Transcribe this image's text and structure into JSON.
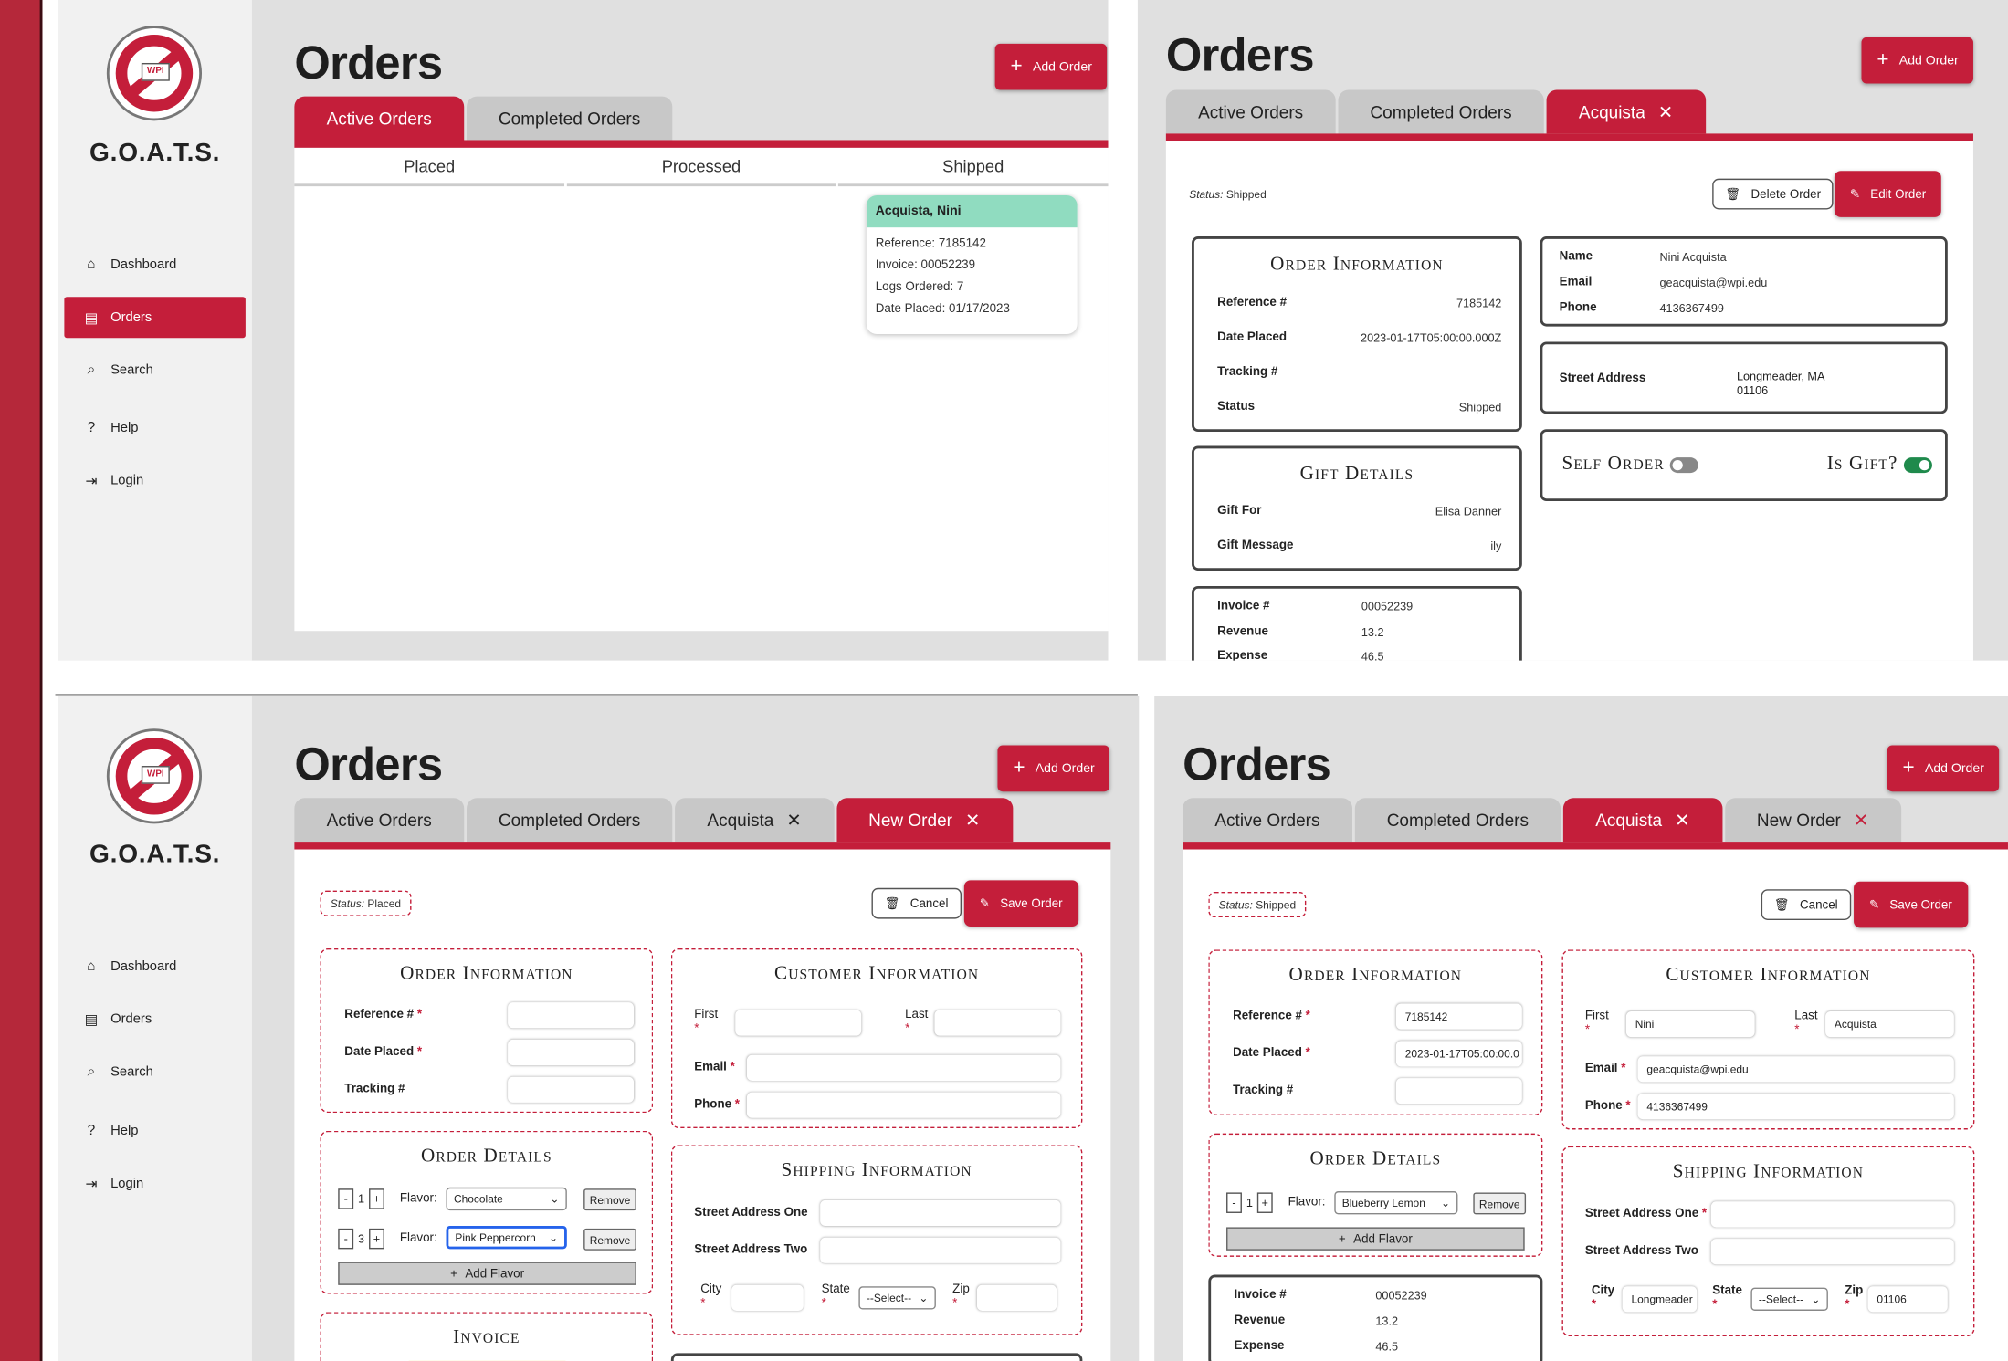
{
  "app": {
    "brand": "G.O.A.T.S.",
    "logo_text": "WPI"
  },
  "sidebar": {
    "items": [
      {
        "label": "Dashboard",
        "icon": "home-icon"
      },
      {
        "label": "Orders",
        "icon": "document-icon"
      },
      {
        "label": "Search",
        "icon": "search-icon"
      },
      {
        "label": "Help",
        "icon": "help-circle-icon"
      },
      {
        "label": "Login",
        "icon": "login-icon"
      }
    ]
  },
  "page": {
    "title": "Orders",
    "add_label": "Add Order"
  },
  "tabs": {
    "active": "Active Orders",
    "completed": "Completed Orders",
    "acquista": "Acquista",
    "new_order": "New Order"
  },
  "board": {
    "columns": [
      "Placed",
      "Processed",
      "Shipped"
    ],
    "card": {
      "name": "Acquista, Nini",
      "reference": "Reference: 7185142",
      "invoice": "Invoice: 00052239",
      "logs": "Logs Ordered: 7",
      "date": "Date Placed: 01/17/2023"
    }
  },
  "detail": {
    "status_label": "Status:",
    "status": "Shipped",
    "delete_label": "Delete Order",
    "edit_label": "Edit Order",
    "order_info": {
      "title": "Order Information",
      "rows": [
        {
          "k": "Reference #",
          "v": "7185142"
        },
        {
          "k": "Date Placed",
          "v": "2023-01-17T05:00:00.000Z"
        },
        {
          "k": "Tracking #",
          "v": ""
        },
        {
          "k": "Status",
          "v": "Shipped"
        }
      ]
    },
    "gift": {
      "title": "Gift Details",
      "rows": [
        {
          "k": "Gift For",
          "v": "Elisa Danner"
        },
        {
          "k": "Gift Message",
          "v": "ily"
        }
      ]
    },
    "invoice_rows": [
      {
        "k": "Invoice #",
        "v": "00052239"
      },
      {
        "k": "Revenue",
        "v": "13.2"
      },
      {
        "k": "Expense",
        "v": "46.5"
      }
    ],
    "customer": [
      {
        "k": "Name",
        "v": "Nini Acquista"
      },
      {
        "k": "Email",
        "v": "geacquista@wpi.edu"
      },
      {
        "k": "Phone",
        "v": "4136367499"
      }
    ],
    "address": {
      "k": "Street Address",
      "v1": "Longmeader, MA",
      "v2": "01106"
    },
    "self_order": "Self Order",
    "is_gift": "Is Gift?"
  },
  "form": {
    "status_label": "Status:",
    "cancel_label": "Cancel",
    "save_label": "Save Order",
    "order_info_title": "Order Information",
    "reference_label": "Reference #",
    "date_label": "Date Placed",
    "tracking_label": "Tracking #",
    "customer_title": "Customer Information",
    "first_label": "First",
    "last_label": "Last",
    "email_label": "Email",
    "phone_label": "Phone",
    "order_details_title": "Order Details",
    "flavor_label": "Flavor:",
    "remove_label": "Remove",
    "add_flavor_label": "Add Flavor",
    "shipping_title": "Shipping Information",
    "street1_label": "Street Address One",
    "street2_label": "Street Address Two",
    "city_label": "City",
    "state_label": "State",
    "zip_label": "Zip",
    "state_select": "--Select--",
    "invoice_title": "Invoice",
    "minus": "-",
    "plus": "+",
    "new_order": {
      "status": "Placed",
      "flavors": [
        {
          "qty": "1",
          "flavor": "Chocolate"
        },
        {
          "qty": "3",
          "flavor": "Pink Peppercorn"
        }
      ]
    },
    "edit_order": {
      "status": "Shipped",
      "reference": "7185142",
      "date": "2023-01-17T05:00:00.0",
      "tracking": "",
      "first": "Nini",
      "last": "Acquista",
      "email": "geacquista@wpi.edu",
      "phone": "4136367499",
      "flavors": [
        {
          "qty": "1",
          "flavor": "Blueberry Lemon"
        }
      ],
      "city": "Longmeader",
      "zip": "01106",
      "invoice_rows": [
        {
          "k": "Invoice #",
          "v": "00052239"
        },
        {
          "k": "Revenue",
          "v": "13.2"
        },
        {
          "k": "Expense",
          "v": "46.5"
        }
      ]
    }
  },
  "colors": {
    "accent": "#c41e3a",
    "card_header": "#90dcc0",
    "toggle_on": "#1f8a4c"
  }
}
